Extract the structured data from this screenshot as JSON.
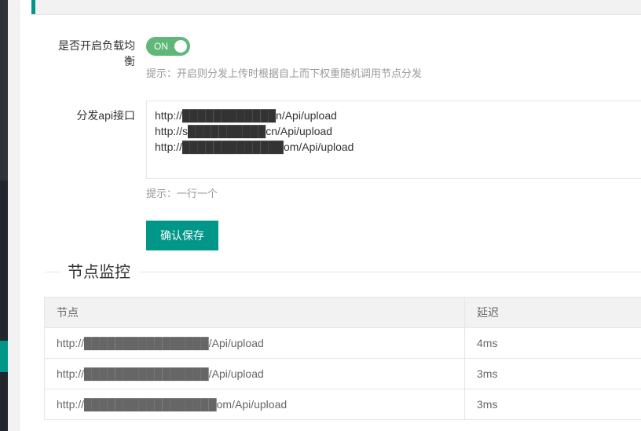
{
  "form": {
    "balance_label": "是否开启负载均衡",
    "switch_text": "ON",
    "balance_hint": "提示：开启则分发上传时根据自上而下权重随机调用节点分发",
    "api_label": "分发api接口",
    "api_lines": [
      "http://████████████n/Api/upload",
      "http://s██████████cn/Api/upload",
      "http://█████████████om/Api/upload"
    ],
    "api_hint": "提示：一行一个",
    "save_label": "确认保存"
  },
  "monitor": {
    "legend": "节点监控",
    "columns": [
      "节点",
      "延迟"
    ],
    "rows": [
      {
        "node": "http://████████████████/Api/upload",
        "latency": "4ms"
      },
      {
        "node": "http://████████████████/Api/upload",
        "latency": "3ms"
      },
      {
        "node": "http://█████████████████om/Api/upload",
        "latency": "3ms"
      }
    ]
  },
  "colors": {
    "accent": "#009688",
    "switch_on": "#5fb878"
  }
}
